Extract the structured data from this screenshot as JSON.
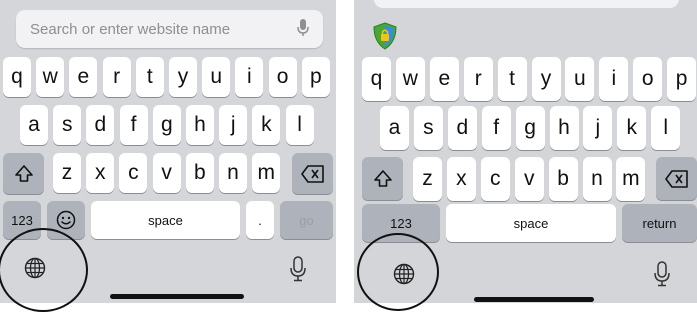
{
  "left": {
    "search_placeholder": "Search or enter website name",
    "row1": [
      "q",
      "w",
      "e",
      "r",
      "t",
      "y",
      "u",
      "i",
      "o",
      "p"
    ],
    "row2": [
      "a",
      "s",
      "d",
      "f",
      "g",
      "h",
      "j",
      "k",
      "l"
    ],
    "row3": [
      "z",
      "x",
      "c",
      "v",
      "b",
      "n",
      "m"
    ],
    "numbers_label": "123",
    "space_label": "space",
    "period_label": ".",
    "go_label": "go"
  },
  "right": {
    "row1": [
      "q",
      "w",
      "e",
      "r",
      "t",
      "y",
      "u",
      "i",
      "o",
      "p"
    ],
    "row2": [
      "a",
      "s",
      "d",
      "f",
      "g",
      "h",
      "j",
      "k",
      "l"
    ],
    "row3": [
      "z",
      "x",
      "c",
      "v",
      "b",
      "n",
      "m"
    ],
    "numbers_label": "123",
    "space_label": "space",
    "return_label": "return"
  },
  "icons": {
    "globe": "globe-icon",
    "mic": "microphone-icon",
    "shift": "shift-icon",
    "delete": "delete-icon",
    "emoji": "emoji-icon",
    "shield": "shield-icon"
  },
  "colors": {
    "keyboard_bg": "#d4d6da",
    "key": "#ffffff",
    "function_key": "#aeb3bb",
    "cursor": "#1a7cf5"
  }
}
